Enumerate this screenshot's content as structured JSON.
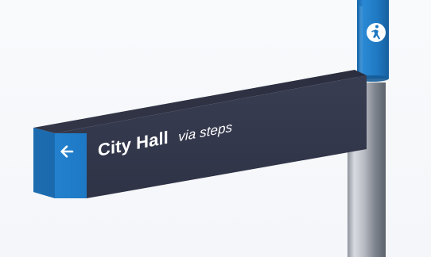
{
  "scene": {
    "background_color": "#f6f8fb"
  },
  "sign": {
    "destination": "City Hall",
    "route_note": "via steps",
    "direction": "left",
    "arrow_icon": "arrow-left-icon",
    "walking_icon": "pedestrian-icon",
    "colors": {
      "blade_face": "#34384d",
      "blade_top": "#2a2d3d",
      "end_cap": "#1f78c1",
      "pole_cap": "#1e77c2",
      "pole_metal": "#b8bcc3",
      "text": "#ffffff"
    }
  }
}
